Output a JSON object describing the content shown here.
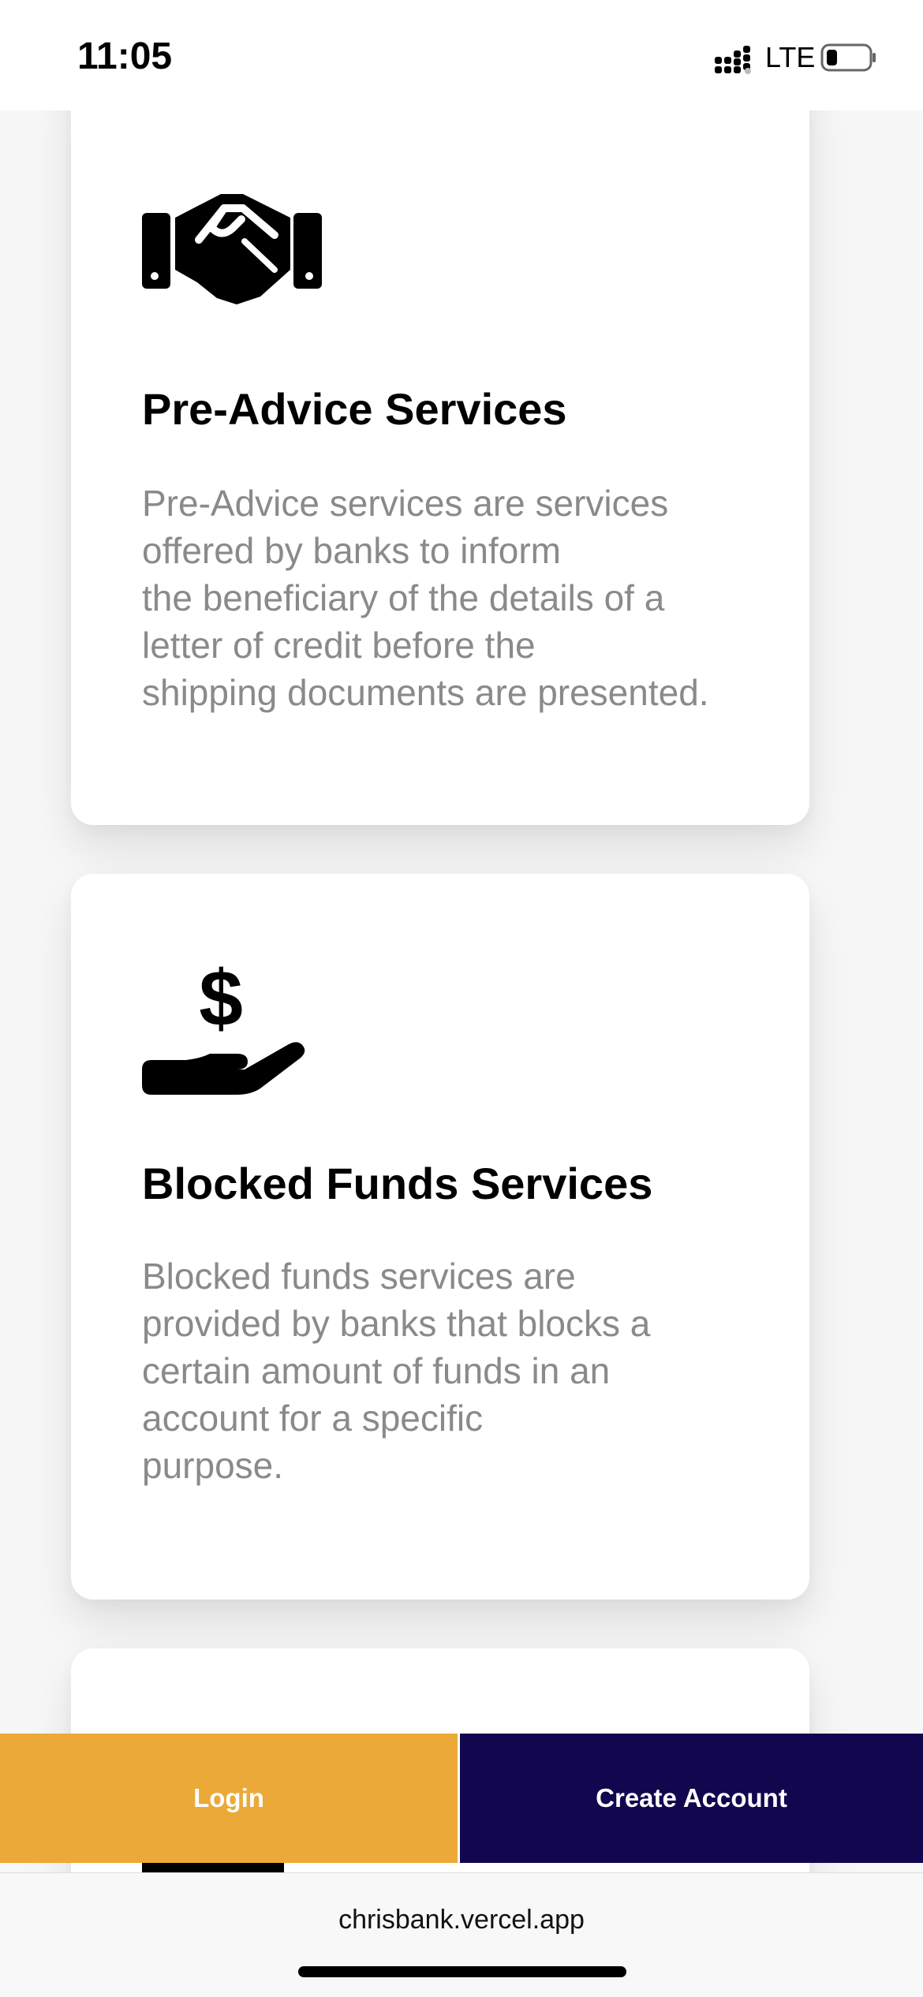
{
  "status_bar": {
    "time": "11:05",
    "network": "LTE"
  },
  "services": [
    {
      "icon": "handshake-icon",
      "title": "Pre-Advice Services",
      "description": "Pre-Advice services are services\noffered by banks to inform\nthe beneficiary of the details of a\nletter of credit before the\nshipping documents are presented."
    },
    {
      "icon": "hand-dollar-icon",
      "title": "Blocked Funds Services",
      "description": "Blocked funds services are\nprovided by banks that blocks a\ncertain amount of funds in an\naccount for a specific\npurpose."
    }
  ],
  "actions": {
    "login_label": "Login",
    "create_account_label": "Create Account"
  },
  "browser": {
    "url": "chrisbank.vercel.app"
  },
  "colors": {
    "login_bg": "#eba937",
    "create_bg": "#12064f",
    "description_text": "#8a8a8a",
    "page_bg": "#f7f7f7"
  }
}
